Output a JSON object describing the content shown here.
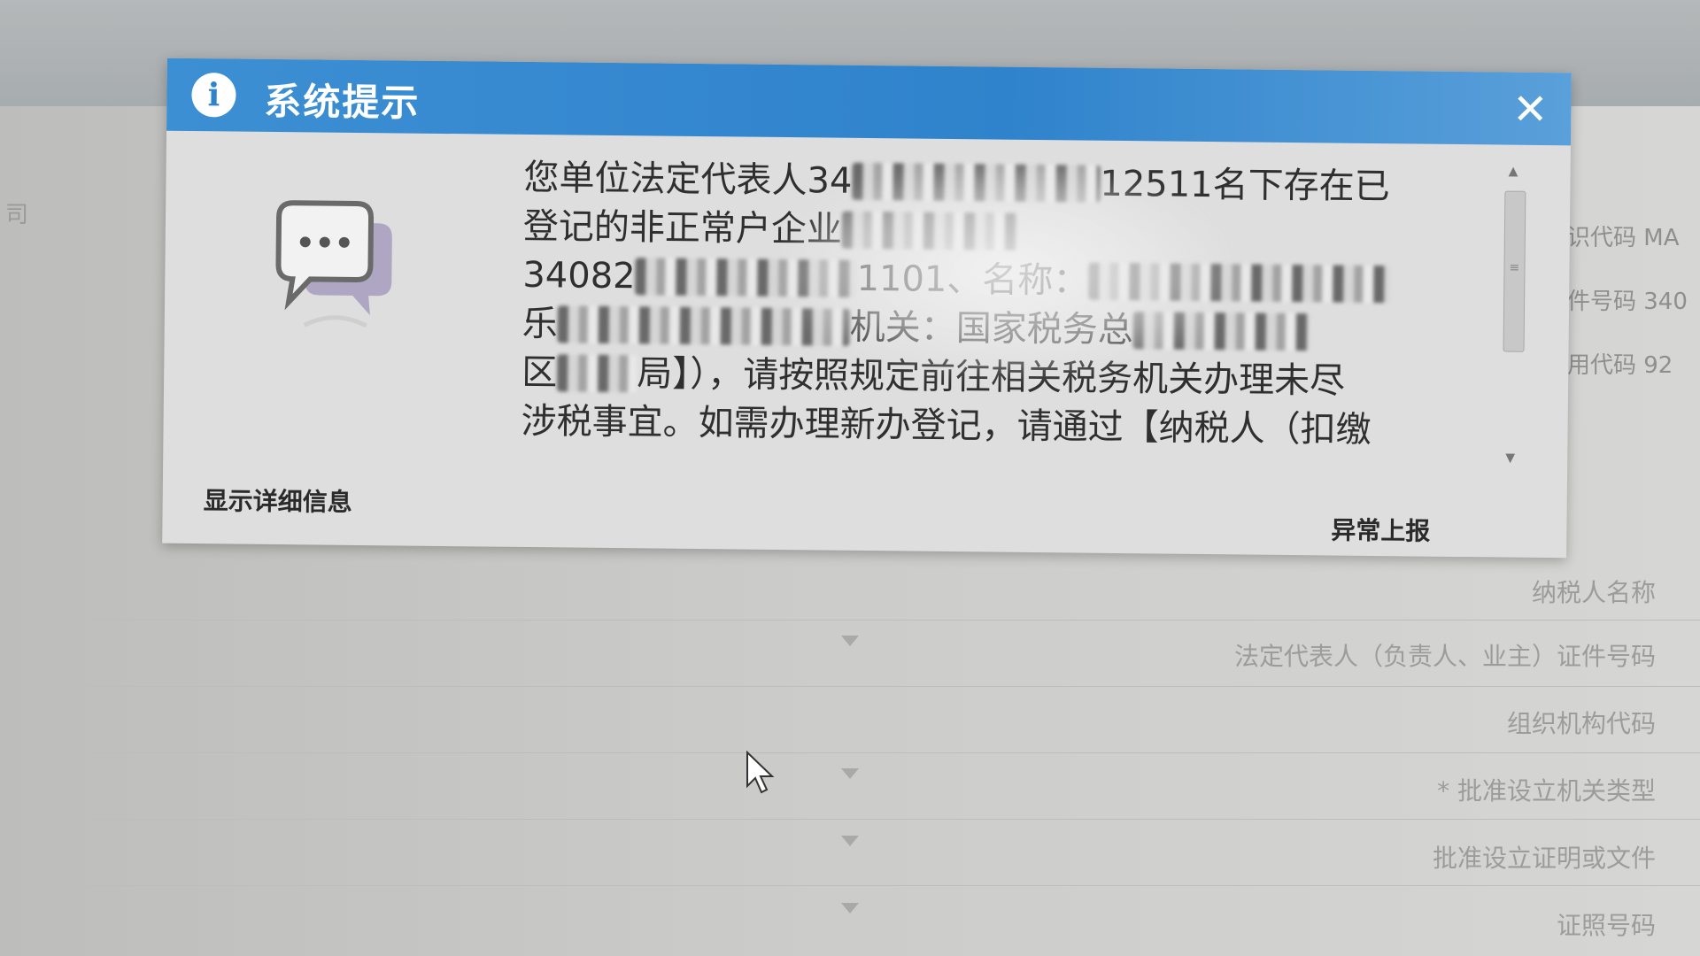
{
  "dialog": {
    "title": "系统提示",
    "message": {
      "l1a": "您单位法定代表人34",
      "l1b": "12511名下存在已",
      "l2": "登记的非正常户企业",
      "l3a": "34082",
      "l3b": "1101、名称：",
      "l4a": "乐",
      "l4b": "机关：国家税务总",
      "l5a": "区",
      "l5b": "局】），请按照规定前往相关税务机关办理未尽",
      "l6": "涉税事宜。如需办理新办登记，请通过【纳税人（扣缴"
    },
    "show_details": "显示详细信息",
    "report": "异常上报"
  },
  "background": {
    "left_text": "司",
    "right_top": [
      "识代码  MA",
      "件号码  340",
      "用代码  92"
    ],
    "labels": [
      "纳税人名称",
      "法定代表人（负责人、业主）证件号码",
      "组织机构代码",
      "* 批准设立机关类型",
      "批准设立证明或文件",
      "证照号码"
    ]
  }
}
